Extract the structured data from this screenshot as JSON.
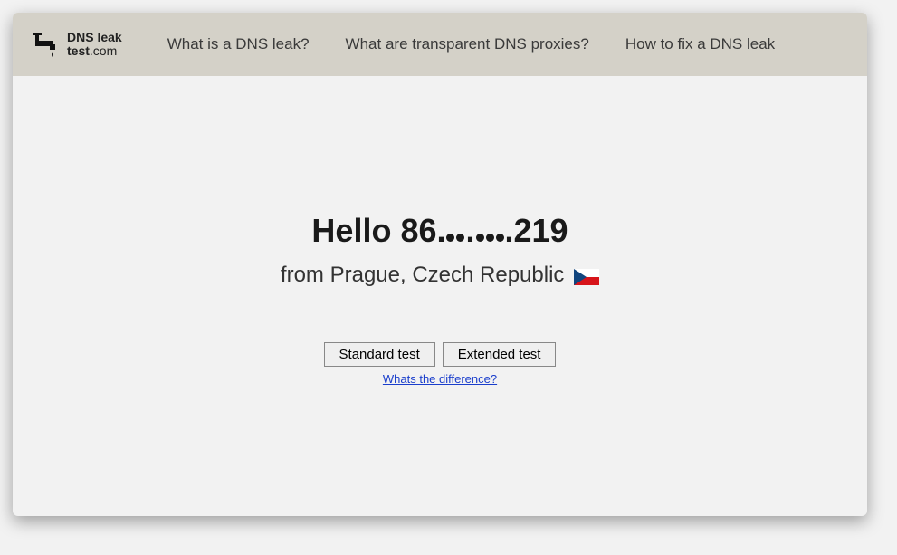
{
  "header": {
    "logo": {
      "line1": "DNS leak",
      "line2_bold": "test",
      "line2_thin": ".com"
    },
    "nav": [
      "What is a DNS leak?",
      "What are transparent DNS proxies?",
      "How to fix a DNS leak"
    ]
  },
  "main": {
    "hello_prefix": "Hello ",
    "ip_first": "86.",
    "ip_sep": ".",
    "ip_last": ".219",
    "from_prefix": "from ",
    "location": "Prague, Czech Republic",
    "flag": "czech-republic"
  },
  "actions": {
    "standard_button": "Standard test",
    "extended_button": "Extended test",
    "difference_link": "Whats the difference?"
  }
}
